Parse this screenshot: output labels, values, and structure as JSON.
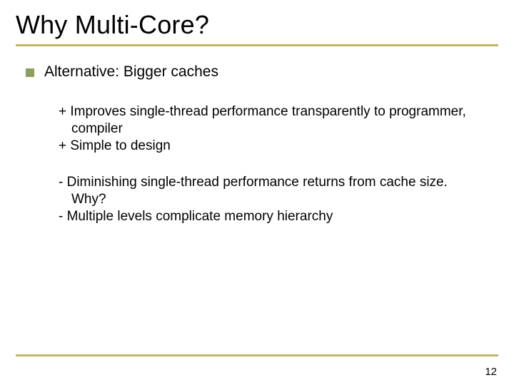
{
  "slide": {
    "title": "Why Multi-Core?",
    "bullet": "Alternative: Bigger caches",
    "pros": [
      "+ Improves single-thread performance transparently to programmer, compiler",
      "+ Simple to design"
    ],
    "cons": [
      "- Diminishing single-thread performance returns from cache size. Why?",
      "- Multiple levels complicate memory hierarchy"
    ],
    "page_number": "12"
  }
}
